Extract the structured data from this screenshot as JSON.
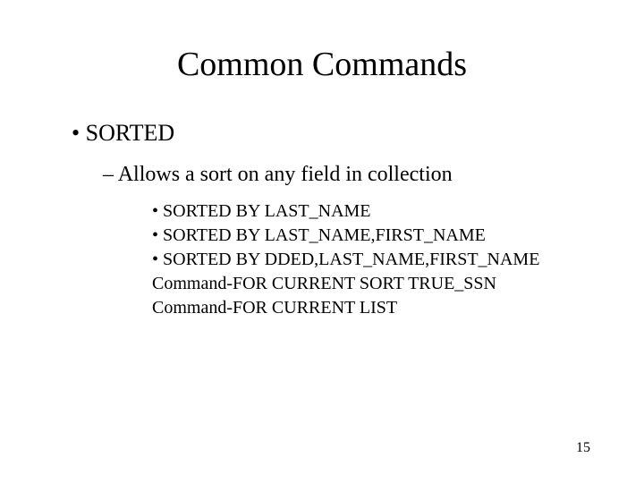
{
  "title": "Common Commands",
  "l1": "SORTED",
  "l2": "Allows a sort on any field in collection",
  "l3": {
    "a": "SORTED BY LAST_NAME",
    "b": "SORTED BY LAST_NAME,FIRST_NAME",
    "c": "SORTED BY DDED,LAST_NAME,FIRST_NAME",
    "d": "Command-FOR CURRENT SORT TRUE_SSN",
    "e": "Command-FOR CURRENT LIST"
  },
  "pageNumber": "15"
}
